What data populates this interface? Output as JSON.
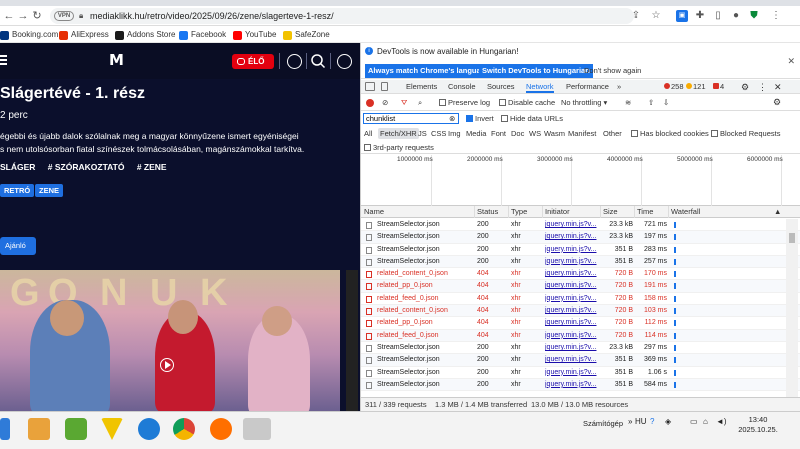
{
  "browser": {
    "url": "mediaklikk.hu/retro/video/2025/09/26/zene/slagerteve-1-resz/",
    "vpn_label": "VPN",
    "bookmarks": [
      {
        "label": "Booking.com",
        "color": "#003580"
      },
      {
        "label": "AliExpress",
        "color": "#e62e04"
      },
      {
        "label": "Addons Store",
        "color": "#1b1b1b"
      },
      {
        "label": "Facebook",
        "color": "#1877f2"
      },
      {
        "label": "YouTube",
        "color": "#ff0000"
      },
      {
        "label": "SafeZone",
        "color": "#f2c200"
      }
    ]
  },
  "site": {
    "live_label": "ÉLŐ",
    "title": "Slágertévé - 1. rész",
    "duration": "2 perc",
    "description_line1": "égebbi és újabb dalok szólalnak meg a magyar könnyűzene ismert egyéniségei",
    "description_line2": "s nem utolsósorban fiatal színészek tolmácsolásában, magánszámokkal tarkítva.",
    "tags": [
      "SLÁGER",
      "# SZÓRAKOZTATÓ",
      "# ZENE"
    ],
    "chips": [
      "RETRÓ",
      "ZENE"
    ],
    "recommend_label": "Ajánló",
    "accent": "#1f6fe0",
    "live_color": "#e3000f"
  },
  "devtools": {
    "info_text": "DevTools is now available in Hungarian!",
    "btn_match": "Always match Chrome's language",
    "btn_switch": "Switch DevTools to Hungarian",
    "btn_dont": "Don't show again",
    "tabs": [
      "Elements",
      "Console",
      "Sources",
      "Network",
      "Performance",
      "»"
    ],
    "active_tab": "Network",
    "errors": "258",
    "warnings": "121",
    "issues": "4",
    "toolbar": {
      "preserve_log": "Preserve log",
      "disable_cache": "Disable cache",
      "throttle": "No throttling"
    },
    "filter_value": "chunklist",
    "invert": "Invert",
    "hide_data_urls": "Hide data URLs",
    "types": [
      "All",
      "Fetch/XHR",
      "JS",
      "CSS",
      "Img",
      "Media",
      "Font",
      "Doc",
      "WS",
      "Wasm",
      "Manifest",
      "Other"
    ],
    "has_blocked_cookies": "Has blocked cookies",
    "blocked_requests": "Blocked Requests",
    "third_party": "3rd-party requests",
    "overview_ticks": [
      "1000000 ms",
      "2000000 ms",
      "3000000 ms",
      "4000000 ms",
      "5000000 ms",
      "6000000 ms"
    ],
    "columns": {
      "name": "Name",
      "status": "Status",
      "type": "Type",
      "initiator": "Initiator",
      "size": "Size",
      "time": "Time",
      "waterfall": "Waterfall"
    },
    "rows": [
      {
        "name": "StreamSelector.json",
        "status": "200",
        "type": "xhr",
        "initiator": "jquery.min.js?v...",
        "size": "23.3 kB",
        "time": "721 ms",
        "err": false
      },
      {
        "name": "StreamSelector.json",
        "status": "200",
        "type": "xhr",
        "initiator": "jquery.min.js?v...",
        "size": "23.3 kB",
        "time": "197 ms",
        "err": false
      },
      {
        "name": "StreamSelector.json",
        "status": "200",
        "type": "xhr",
        "initiator": "jquery.min.js?v...",
        "size": "351 B",
        "time": "283 ms",
        "err": false
      },
      {
        "name": "StreamSelector.json",
        "status": "200",
        "type": "xhr",
        "initiator": "jquery.min.js?v...",
        "size": "351 B",
        "time": "257 ms",
        "err": false
      },
      {
        "name": "related_content_0.json",
        "status": "404",
        "type": "xhr",
        "initiator": "jquery.min.js?v...",
        "size": "720 B",
        "time": "170 ms",
        "err": true
      },
      {
        "name": "related_pp_0.json",
        "status": "404",
        "type": "xhr",
        "initiator": "jquery.min.js?v...",
        "size": "720 B",
        "time": "191 ms",
        "err": true
      },
      {
        "name": "related_feed_0.json",
        "status": "404",
        "type": "xhr",
        "initiator": "jquery.min.js?v...",
        "size": "720 B",
        "time": "158 ms",
        "err": true
      },
      {
        "name": "related_content_0.json",
        "status": "404",
        "type": "xhr",
        "initiator": "jquery.min.js?v...",
        "size": "720 B",
        "time": "103 ms",
        "err": true
      },
      {
        "name": "related_pp_0.json",
        "status": "404",
        "type": "xhr",
        "initiator": "jquery.min.js?v...",
        "size": "720 B",
        "time": "112 ms",
        "err": true
      },
      {
        "name": "related_feed_0.json",
        "status": "404",
        "type": "xhr",
        "initiator": "jquery.min.js?v...",
        "size": "720 B",
        "time": "114 ms",
        "err": true
      },
      {
        "name": "StreamSelector.json",
        "status": "200",
        "type": "xhr",
        "initiator": "jquery.min.js?v...",
        "size": "23.3 kB",
        "time": "297 ms",
        "err": false
      },
      {
        "name": "StreamSelector.json",
        "status": "200",
        "type": "xhr",
        "initiator": "jquery.min.js?v...",
        "size": "351 B",
        "time": "369 ms",
        "err": false
      },
      {
        "name": "StreamSelector.json",
        "status": "200",
        "type": "xhr",
        "initiator": "jquery.min.js?v...",
        "size": "351 B",
        "time": "1.06 s",
        "err": false
      },
      {
        "name": "StreamSelector.json",
        "status": "200",
        "type": "xhr",
        "initiator": "jquery.min.js?v...",
        "size": "351 B",
        "time": "584 ms",
        "err": false
      }
    ],
    "status_bar": {
      "requests": "311 / 339 requests",
      "transferred": "1.3 MB / 1.4 MB transferred",
      "resources": "13.0 MB / 13.0 MB resources"
    }
  },
  "taskbar": {
    "tray_label": "Számítógép",
    "lang": "HU",
    "time": "13:40",
    "date": "2025.10.25."
  }
}
